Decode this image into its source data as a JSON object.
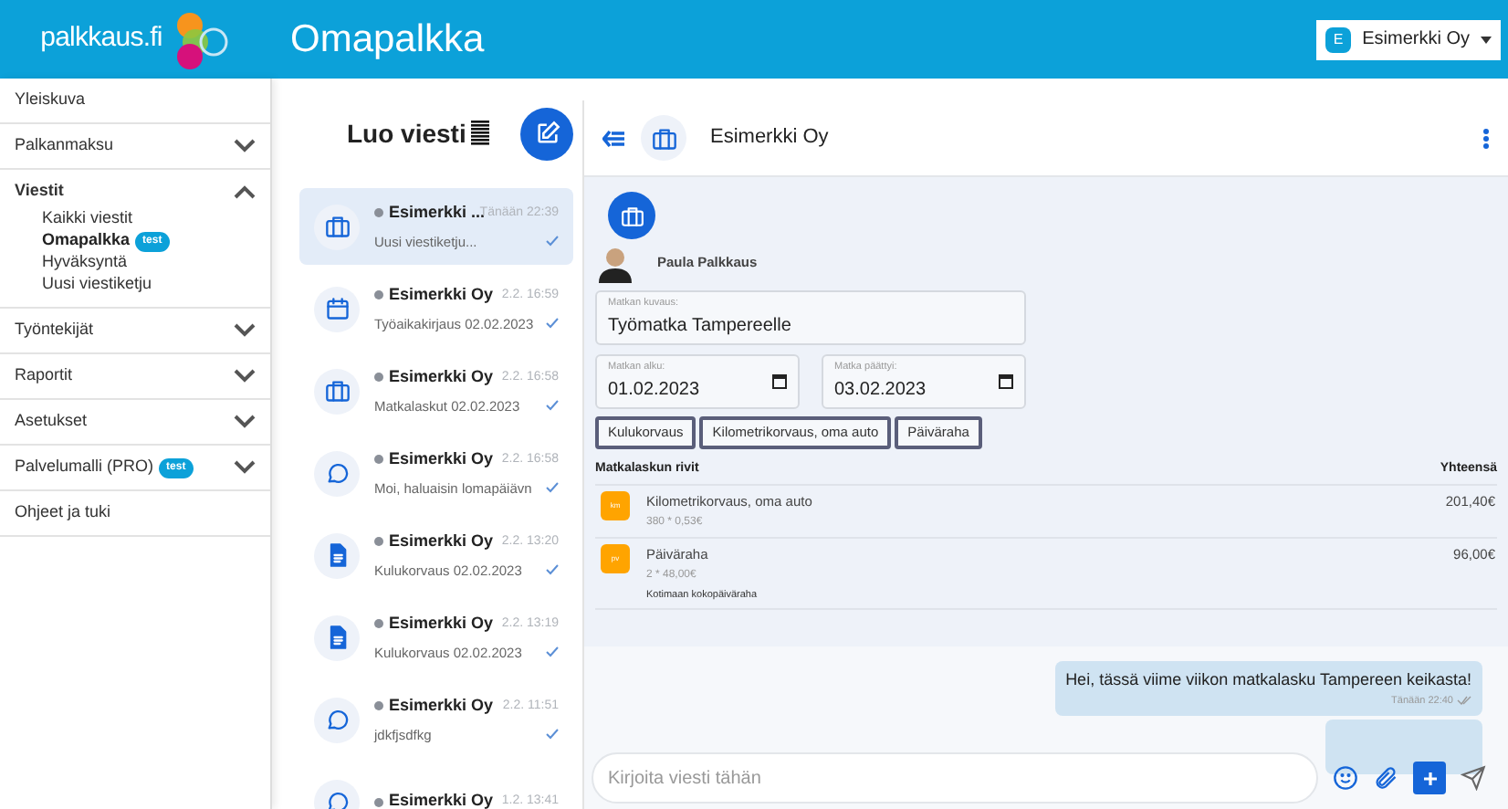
{
  "header": {
    "logo": "palkkaus.fi",
    "title": "Omapalkka",
    "account": {
      "initial": "E",
      "name": "Esimerkki Oy"
    }
  },
  "sidebar": {
    "items": [
      {
        "label": "Yleiskuva"
      },
      {
        "label": "Palkanmaksu",
        "expanded": false
      },
      {
        "label": "Viestit",
        "expanded": true,
        "children": [
          {
            "label": "Kaikki viestit",
            "selected": false
          },
          {
            "label": "Omapalkka",
            "selected": true,
            "badge": "test"
          },
          {
            "label": "Hyväksyntä",
            "selected": false
          },
          {
            "label": "Uusi viestiketju",
            "selected": false
          }
        ]
      },
      {
        "label": "Työntekijät",
        "expanded": false
      },
      {
        "label": "Raportit",
        "expanded": false
      },
      {
        "label": "Asetukset",
        "expanded": false
      },
      {
        "label": "Palvelumalli (PRO)",
        "badge": "test",
        "expanded": false
      },
      {
        "label": "Ohjeet ja tuki"
      }
    ]
  },
  "messages": {
    "title": "Luo viesti",
    "items": [
      {
        "kind": "briefcase",
        "sender": "Esimerkki ...",
        "time": "Tänään 22:39",
        "preview": "Uusi viestiketju...",
        "selected": true
      },
      {
        "kind": "calendar",
        "sender": "Esimerkki Oy",
        "time": "2.2. 16:59",
        "preview": "Työaikakirjaus 02.02.2023",
        "selected": false
      },
      {
        "kind": "briefcase",
        "sender": "Esimerkki Oy",
        "time": "2.2. 16:58",
        "preview": "Matkalaskut 02.02.2023",
        "selected": false
      },
      {
        "kind": "chat",
        "sender": "Esimerkki Oy",
        "time": "2.2. 16:58",
        "preview": "Moi, haluaisin lomapäiävn",
        "selected": false
      },
      {
        "kind": "document",
        "sender": "Esimerkki Oy",
        "time": "2.2. 13:20",
        "preview": "Kulukorvaus 02.02.2023",
        "selected": false
      },
      {
        "kind": "document",
        "sender": "Esimerkki Oy",
        "time": "2.2. 13:19",
        "preview": "Kulukorvaus 02.02.2023",
        "selected": false
      },
      {
        "kind": "chat",
        "sender": "Esimerkki Oy",
        "time": "2.2. 11:51",
        "preview": "jdkfjsdfkg",
        "selected": false
      },
      {
        "kind": "chat",
        "sender": "Esimerkki Oy",
        "time": "1.2. 13:41",
        "selected": false
      }
    ]
  },
  "chat": {
    "title": "Esimerkki Oy",
    "form": {
      "person": "Paula Palkkaus",
      "description": {
        "label": "Matkan kuvaus:",
        "value": "Työmatka Tampereelle"
      },
      "start": {
        "label": "Matkan alku:",
        "value": "01.02.2023"
      },
      "end": {
        "label": "Matka päättyi:",
        "value": "03.02.2023"
      },
      "buttons": [
        "Kulukorvaus",
        "Kilometrikorvaus, oma auto",
        "Päiväraha"
      ],
      "table": {
        "columns": [
          "Matkalaskun rivit",
          "Yhteensä"
        ],
        "rows": [
          {
            "icon": "km",
            "title": "Kilometrikorvaus, oma auto",
            "detail": "380 * 0,53€",
            "total": "201,40€"
          },
          {
            "icon": "pv",
            "title": "Päiväraha",
            "detail": "2 * 48,00€",
            "note": "Kotimaan kokopäiväraha",
            "total": "96,00€"
          }
        ]
      }
    },
    "bubble": {
      "text": "Hei, tässä viime viikon matkalasku Tampereen keikasta!",
      "time": "Tänään 22:40"
    },
    "input": {
      "placeholder": "Kirjoita viesti tähän"
    }
  }
}
